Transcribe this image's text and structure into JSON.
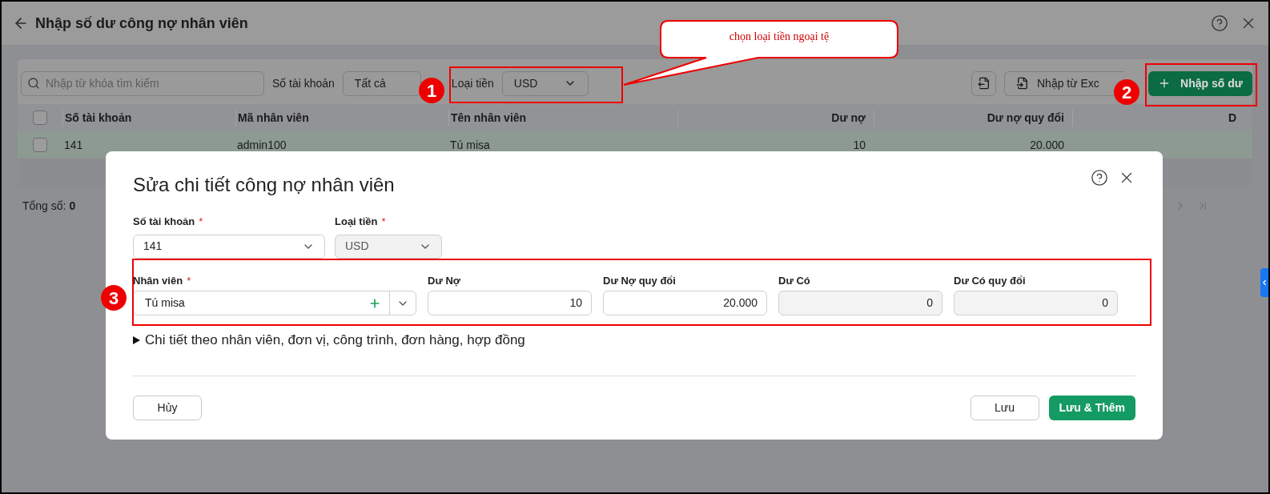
{
  "page": {
    "title": "Nhập số dư công nợ nhân viên"
  },
  "toolbar": {
    "search": {
      "placeholder": "Nhập từ khóa tìm kiếm"
    },
    "account_filter": {
      "label": "Số tài khoản",
      "value": "Tất cả"
    },
    "currency_filter": {
      "label": "Loại tiền",
      "value": "USD"
    },
    "import_button": {
      "label": "Nhập từ Exc"
    },
    "add_button": {
      "label": "Nhập số dư"
    }
  },
  "table": {
    "header_checked": false,
    "columns": [
      {
        "label": "Số tài khoản"
      },
      {
        "label": "Mã nhân viên"
      },
      {
        "label": "Tên nhân viên"
      },
      {
        "label": "Dư nợ"
      },
      {
        "label": "Dư nợ quy đổi"
      },
      {
        "label": "D"
      }
    ],
    "rows": [
      {
        "checked": false,
        "selected": true,
        "cells": [
          "141",
          "admin100",
          "Tú misa",
          "10",
          "20.000"
        ]
      }
    ]
  },
  "footer": {
    "total_label": "Tổng số:",
    "total_value": "0"
  },
  "dialog": {
    "title": "Sửa chi tiết công nợ nhân viên",
    "top_fields": [
      {
        "label": "Số tài khoản",
        "required_mark": "*",
        "value": "141",
        "disabled": false
      },
      {
        "label": "Loại tiền",
        "required_mark": "*",
        "value": "USD",
        "disabled": true
      }
    ],
    "amount_fields": [
      {
        "kind": "combo",
        "label": "Nhân viên",
        "required_mark": "*",
        "value": "Tú misa",
        "disabled": false
      },
      {
        "kind": "number",
        "label": "Dư Nợ",
        "value": "10",
        "disabled": false
      },
      {
        "kind": "number",
        "label": "Dư Nợ quy đổi",
        "value": "20.000",
        "disabled": false
      },
      {
        "kind": "number",
        "label": "Dư Có",
        "value": "0",
        "disabled": true
      },
      {
        "kind": "number",
        "label": "Dư Có quy đổi",
        "value": "0",
        "disabled": true
      }
    ],
    "details_toggle": {
      "label": "Chi tiết theo nhân viên, đơn vị, công trình, đơn hàng, hợp đồng",
      "expanded": false
    },
    "buttons": [
      {
        "label": "Hủy",
        "kind": "secondary"
      },
      {
        "label": "Lưu",
        "kind": "secondary"
      },
      {
        "label": "Lưu & Thêm",
        "kind": "primary"
      }
    ]
  },
  "annotations": {
    "callout": "chọn loại tiền ngoại tệ",
    "markers": [
      "1",
      "2",
      "3"
    ]
  }
}
